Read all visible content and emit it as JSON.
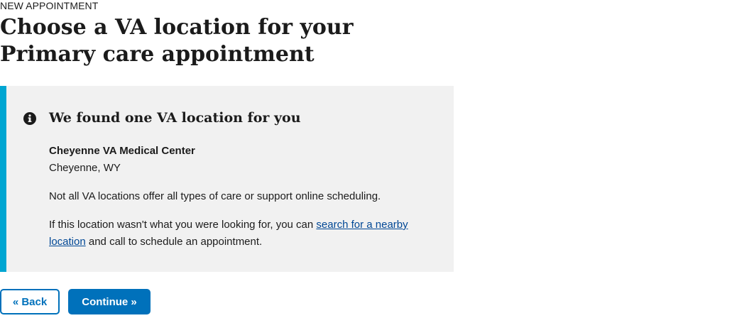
{
  "header": {
    "eyebrow": "NEW APPOINTMENT",
    "title": "Choose a VA location for your Primary care appointment"
  },
  "alert": {
    "icon": "info-icon",
    "heading": "We found one VA location for you",
    "facility_name": "Cheyenne VA Medical Center",
    "facility_city": "Cheyenne, WY",
    "note": "Not all VA locations offer all types of care or support online scheduling.",
    "help_prefix": "If this location wasn't what you were looking for, you can ",
    "help_link": "search for a nearby location",
    "help_suffix": " and call to schedule an appointment.",
    "accent_color": "#00a6d2",
    "background_color": "#f1f1f1"
  },
  "actions": {
    "back_label": "« Back",
    "continue_label": "Continue »",
    "primary_color": "#0071bb"
  }
}
